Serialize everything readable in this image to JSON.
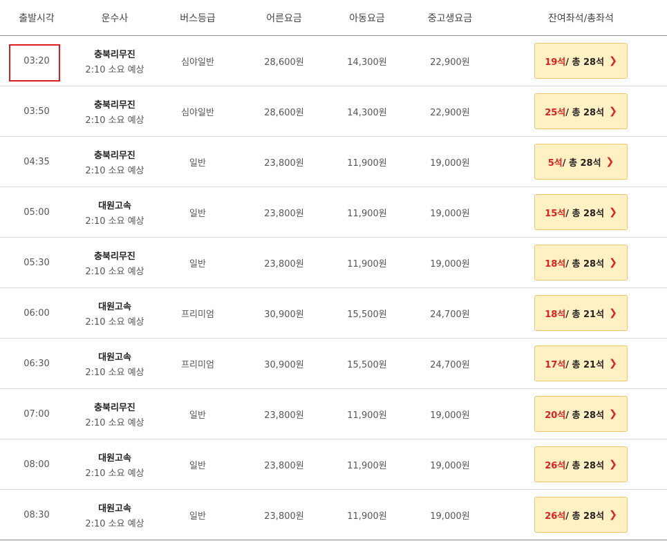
{
  "header": {
    "departure": "출발시각",
    "company": "운수사",
    "grade": "버스등급",
    "adult": "어른요금",
    "child": "아동요금",
    "student": "중고생요금",
    "seats": "잔여좌석/총좌석"
  },
  "rows": [
    {
      "time": "03:20",
      "company": "충북리무진",
      "duration": "2:10 소요 예상",
      "grade": "심야일반",
      "adult": "28,600원",
      "child": "14,300원",
      "student": "22,900원",
      "remain": "19석",
      "total": " / 총 28석"
    },
    {
      "time": "03:50",
      "company": "충북리무진",
      "duration": "2:10 소요 예상",
      "grade": "심야일반",
      "adult": "28,600원",
      "child": "14,300원",
      "student": "22,900원",
      "remain": "25석",
      "total": " / 총 28석"
    },
    {
      "time": "04:35",
      "company": "충북리무진",
      "duration": "2:10 소요 예상",
      "grade": "일반",
      "adult": "23,800원",
      "child": "11,900원",
      "student": "19,000원",
      "remain": "5석",
      "total": " / 총 28석"
    },
    {
      "time": "05:00",
      "company": "대원고속",
      "duration": "2:10 소요 예상",
      "grade": "일반",
      "adult": "23,800원",
      "child": "11,900원",
      "student": "19,000원",
      "remain": "15석",
      "total": " / 총 28석"
    },
    {
      "time": "05:30",
      "company": "충북리무진",
      "duration": "2:10 소요 예상",
      "grade": "일반",
      "adult": "23,800원",
      "child": "11,900원",
      "student": "19,000원",
      "remain": "18석",
      "total": " / 총 28석"
    },
    {
      "time": "06:00",
      "company": "대원고속",
      "duration": "2:10 소요 예상",
      "grade": "프리미엄",
      "adult": "30,900원",
      "child": "15,500원",
      "student": "24,700원",
      "remain": "18석",
      "total": " / 총 21석"
    },
    {
      "time": "06:30",
      "company": "대원고속",
      "duration": "2:10 소요 예상",
      "grade": "프리미엄",
      "adult": "30,900원",
      "child": "15,500원",
      "student": "24,700원",
      "remain": "17석",
      "total": " / 총 21석"
    },
    {
      "time": "07:00",
      "company": "충북리무진",
      "duration": "2:10 소요 예상",
      "grade": "일반",
      "adult": "23,800원",
      "child": "11,900원",
      "student": "19,000원",
      "remain": "20석",
      "total": " / 총 28석"
    },
    {
      "time": "08:00",
      "company": "대원고속",
      "duration": "2:10 소요 예상",
      "grade": "일반",
      "adult": "23,800원",
      "child": "11,900원",
      "student": "19,000원",
      "remain": "26석",
      "total": " / 총 28석"
    },
    {
      "time": "08:30",
      "company": "대원고속",
      "duration": "2:10 소요 예상",
      "grade": "일반",
      "adult": "23,800원",
      "child": "11,900원",
      "student": "19,000원",
      "remain": "26석",
      "total": " / 총 28석"
    }
  ],
  "chevron_icon": "chevron-right-icon",
  "colors": {
    "accent": "#e0201c",
    "button_bg": "#fff1c4",
    "button_border": "#f0c46a",
    "highlight": "#e11b1b"
  }
}
